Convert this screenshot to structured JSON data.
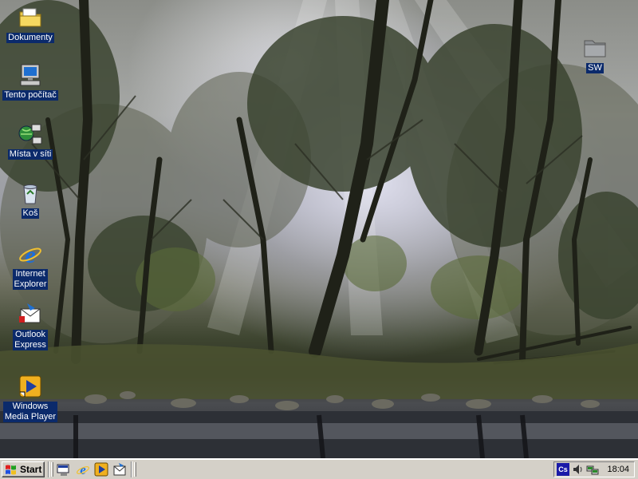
{
  "desktop": {
    "icons": [
      {
        "label": "Dokumenty",
        "icon": "folder-documents-icon"
      },
      {
        "label": "Tento počítač",
        "icon": "my-computer-icon"
      },
      {
        "label": "Místa v síti",
        "icon": "network-places-icon"
      },
      {
        "label": "Koš",
        "icon": "recycle-bin-icon"
      },
      {
        "label": "Internet\nExplorer",
        "icon": "internet-explorer-icon"
      },
      {
        "label": "Outlook\nExpress",
        "icon": "outlook-express-icon"
      },
      {
        "label": "Windows\nMedia Player",
        "icon": "media-player-icon"
      },
      {
        "label": "SW",
        "icon": "folder-icon"
      }
    ]
  },
  "taskbar": {
    "start_label": "Start",
    "quick_launch": [
      "show-desktop-icon",
      "internet-explorer-icon",
      "media-player-icon",
      "outlook-icon"
    ],
    "tray": {
      "language": "Cs",
      "icons": [
        "volume-icon",
        "network-icon"
      ],
      "clock": "18:04"
    }
  },
  "colors": {
    "taskbar": "#d4d0c8",
    "icon_label_bg": "#0b2a6b",
    "language_badge": "#1a1aa8"
  }
}
